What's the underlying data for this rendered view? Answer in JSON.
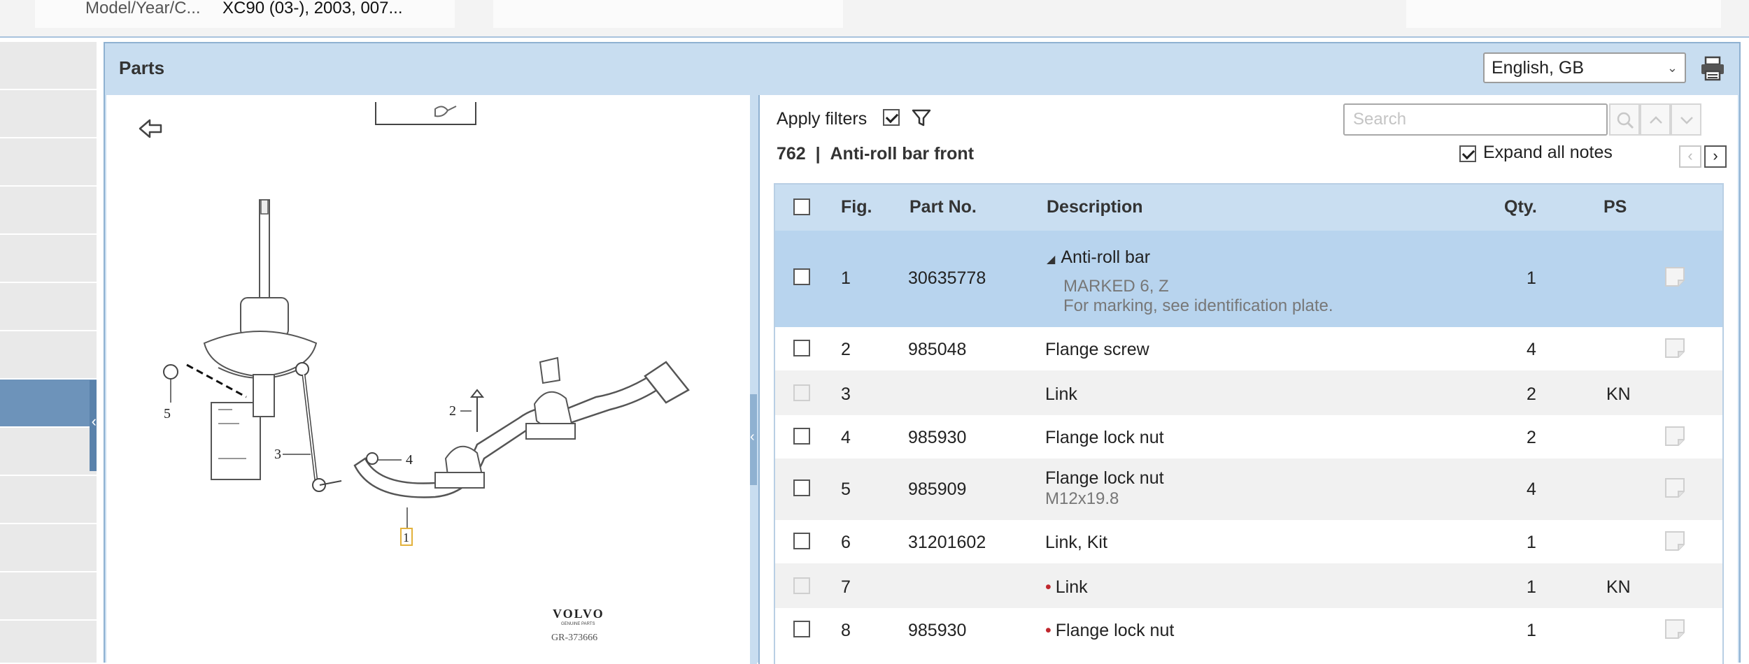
{
  "topbar": {
    "model_label": "Model/Year/C...",
    "model_value": "XC90 (03-), 2003, 007..."
  },
  "panel": {
    "title": "Parts",
    "language": "English, GB"
  },
  "drawing": {
    "brand": "VOLVO",
    "brand_sub": "GENUINE PARTS",
    "figure_id": "GR-373666",
    "callouts": [
      "5",
      "3",
      "4",
      "2",
      "1"
    ]
  },
  "list": {
    "apply_filters_label": "Apply filters",
    "apply_filters_checked": true,
    "search_placeholder": "Search",
    "section_number": "762",
    "section_name": "Anti-roll bar front",
    "section_title": "762  |  Anti-roll bar front",
    "expand_notes_label": "Expand all notes",
    "expand_notes_checked": true,
    "columns": {
      "fig": "Fig.",
      "part_no": "Part No.",
      "description": "Description",
      "qty": "Qty.",
      "ps": "PS"
    },
    "rows": [
      {
        "fig": "1",
        "part_no": "30635778",
        "description": "Anti-roll bar",
        "sub1": "MARKED 6, Z",
        "sub2": "For marking, see identification plate.",
        "qty": "1",
        "ps": ""
      },
      {
        "fig": "2",
        "part_no": "985048",
        "description": "Flange screw",
        "qty": "4",
        "ps": ""
      },
      {
        "fig": "3",
        "part_no": "",
        "description": "Link",
        "qty": "2",
        "ps": "KN"
      },
      {
        "fig": "4",
        "part_no": "985930",
        "description": "Flange lock nut",
        "qty": "2",
        "ps": ""
      },
      {
        "fig": "5",
        "part_no": "985909",
        "description": "Flange lock nut",
        "sub1": "M12x19.8",
        "qty": "4",
        "ps": ""
      },
      {
        "fig": "6",
        "part_no": "31201602",
        "description": "Link, Kit",
        "qty": "1",
        "ps": ""
      },
      {
        "fig": "7",
        "part_no": "",
        "description": "Link",
        "qty": "1",
        "ps": "KN"
      },
      {
        "fig": "8",
        "part_no": "985930",
        "description": "Flange lock nut",
        "qty": "1",
        "ps": ""
      }
    ]
  },
  "colors": {
    "panel_bg": "#c8ddf0",
    "selected_row": "#b8d4ee",
    "sidebar_active": "#6d93ba",
    "bullet_red": "#c0272d"
  }
}
